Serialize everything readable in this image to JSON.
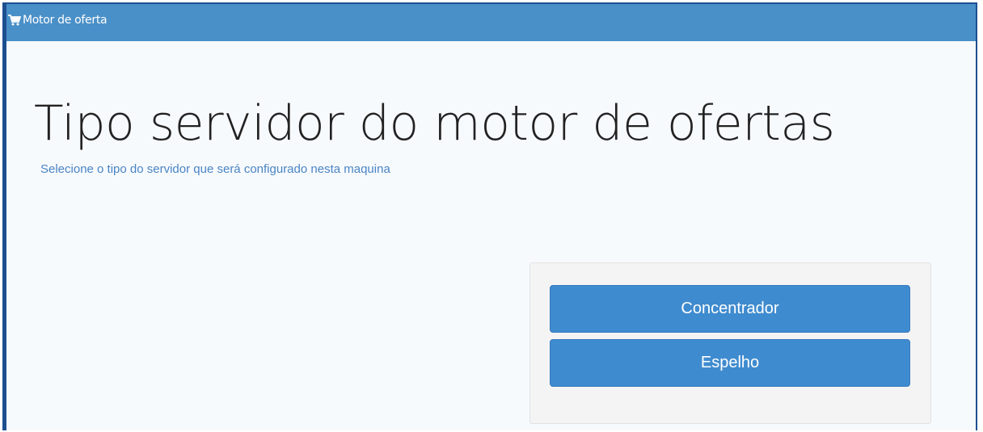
{
  "window": {
    "title": "Motor de oferta",
    "icon": "cart-icon"
  },
  "page": {
    "heading": "Tipo servidor do motor de ofertas",
    "subtitle": "Selecione o tipo do servidor que será configurado nesta maquina"
  },
  "options": {
    "concentrador_label": "Concentrador",
    "espelho_label": "Espelho"
  },
  "colors": {
    "titlebar": "#4a90c8",
    "window_border": "#1d4f8f",
    "button": "#3f8bcf",
    "subtitle": "#4a84c4"
  }
}
